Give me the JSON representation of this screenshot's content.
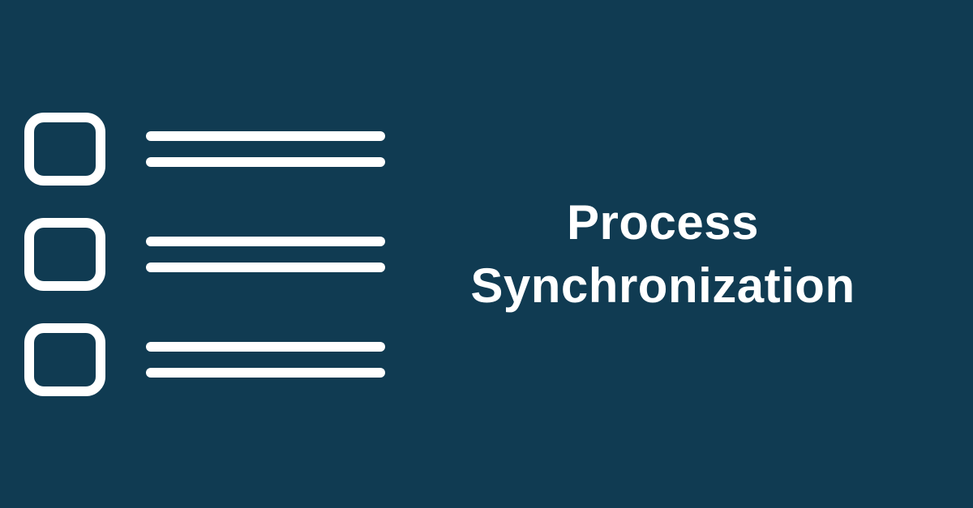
{
  "title": {
    "line1": "Process",
    "line2": "Synchronization"
  },
  "colors": {
    "background": "#103b52",
    "foreground": "#ffffff"
  }
}
